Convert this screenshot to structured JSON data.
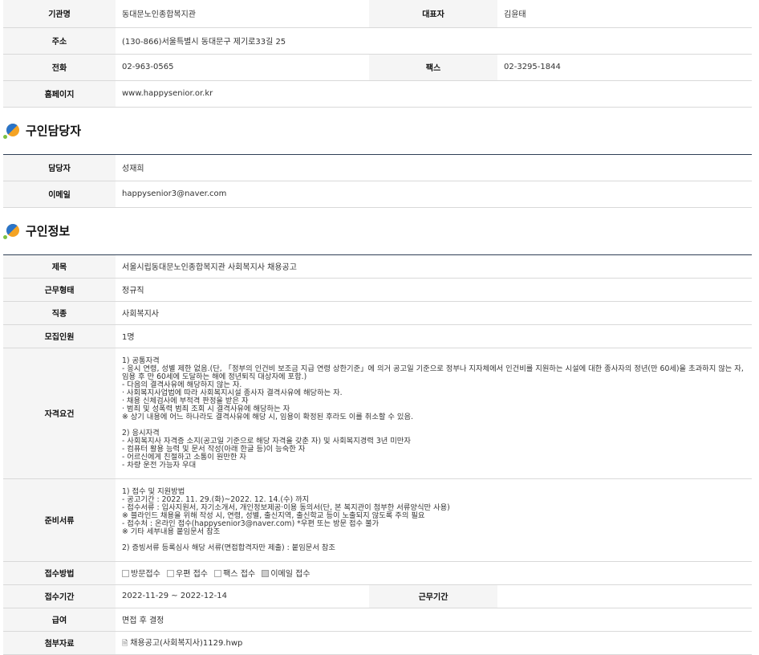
{
  "agency": {
    "rows": {
      "name_label": "기관명",
      "name_value": "동대문노인종합복지관",
      "rep_label": "대표자",
      "rep_value": "김윤태",
      "addr_label": "주소",
      "addr_value": "(130-866)서울특별시 동대문구 제기로33길 25",
      "tel_label": "전화",
      "tel_value": "02-963-0565",
      "fax_label": "팩스",
      "fax_value": "02-3295-1844",
      "home_label": "홈페이지",
      "home_value": "www.happysenior.or.kr"
    }
  },
  "contact": {
    "title": "구인담당자",
    "manager_label": "담당자",
    "manager_value": "성재희",
    "email_label": "이메일",
    "email_value": "happysenior3@naver.com"
  },
  "job": {
    "title": "구인정보",
    "subject_label": "제목",
    "subject_value": "서울시립동대문노인종합복지관 사회복지사 채용공고",
    "type_label": "근무형태",
    "type_value": "정규직",
    "role_label": "직종",
    "role_value": "사회복지사",
    "count_label": "모집인원",
    "count_value": "1명",
    "qual_label": "자격요건",
    "qual_value": "1) 공통자격\n- 응시 연령, 성별 제한 없음.(단, 「정부의 인건비 보조금 지급 연령 상한기준」에 의거 공고일 기준으로 정부나 지자체에서 인건비를 지원하는 시설에 대한 종사자의 정년(만 60세)을 초과하지 않는 자, 임용 후 만 60세에 도달하는 해에 정년퇴직 대상자에 포함.)\n- 다음의 결격사유에 해당하지 않는 자.\n  · 사회복지사업법에 따라 사회복지시설 종사자 결격사유에 해당하는 자.\n  · 채용 신체검사에 부적격 판정을 받은 자\n  · 범죄 및 성폭력 범죄 조회 시 결격사유에 해당하는 자\n※ 상기 내용에 어느 하나라도 결격사유에 해당 시, 임용이 확정된 후라도 이를 취소할 수 있음.\n\n2) 응시자격\n- 사회복지사 자격증 소지(공고일 기준으로 해당 자격을 갖춘 자) 및 사회복지경력 3년 미만자\n- 컴퓨터 활용 능력 및 문서 작성(아래 한글 등)이 능숙한 자\n- 어르신에게 친절하고 소통이 원만한 자\n- 차량 운전 가능자 우대",
    "docs_label": "준비서류",
    "docs_value": "1) 접수 및 지원방법\n- 공고기간 : 2022. 11. 29.(화)~2022. 12. 14.(수) 까지\n- 접수서류 : 입사지원서, 자기소개서, 개인정보제공·이용 동의서(단, 본 복지관이 첨부한 서류양식만 사용)\n※ 블라인드 채용을 위해 작성 시, 연령, 성별, 출신지역, 출신학교 등이 노출되지 않도록 주의 필요\n- 접수처 : 온라인 접수(happysenior3@naver.com) *우편 또는 방문 접수 불가\n※ 기타 세부내용 붙임문서 참조\n\n2) 증빙서류 등록심사 해당 서류(면접합격자만 제출) : 붙임문서 참조",
    "method_label": "접수방법",
    "methods": [
      "방문접수",
      "우편 접수",
      "팩스 접수",
      "이메일 접수"
    ],
    "methods_checked": [
      false,
      false,
      false,
      true
    ],
    "period_label": "접수기간",
    "period_value": "2022-11-29 ~ 2022-12-14",
    "work_period_label": "근무기간",
    "work_period_value": "",
    "salary_label": "급여",
    "salary_value": "면접 후 결정",
    "attach_label": "첨부자료",
    "attach_value": "채용공고(사회복지사)1129.hwp"
  }
}
